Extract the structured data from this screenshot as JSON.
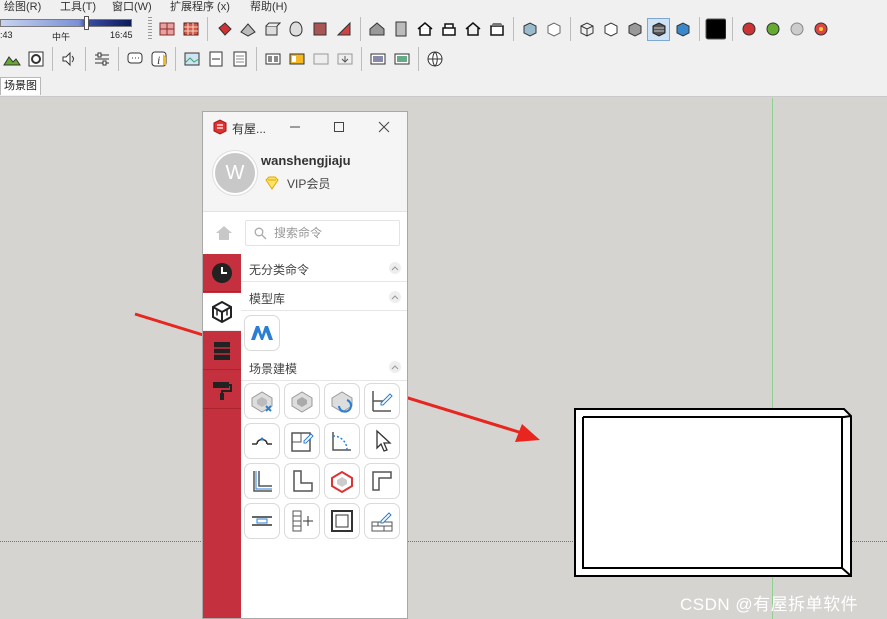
{
  "menubar": {
    "items": [
      "绘图(R)",
      "工具(T)",
      "窗口(W)",
      "扩展程序 (x)",
      "帮助(H)"
    ]
  },
  "shadow": {
    "time_start": ":43",
    "time_mid": "中午",
    "time_end": "16:45",
    "position": 0.64
  },
  "scenes_tab": "场景图",
  "plugin": {
    "title": "有屋...",
    "user": {
      "avatar_letter": "W",
      "name": "wanshengjiaju",
      "badge": "VIP会员"
    },
    "search_placeholder": "搜索命令",
    "sections": {
      "uncategorized": "无分类命令",
      "model_library": "模型库",
      "scene_modeling": "场景建模"
    }
  },
  "watermark": "CSDN @有屋拆单软件",
  "colors": {
    "accent_red": "#c5303e",
    "viewport_bg": "#d5d4d1",
    "axis_green": "#8fcf8f",
    "axis_red": "#d05050",
    "arrow_red": "#e8261f"
  }
}
